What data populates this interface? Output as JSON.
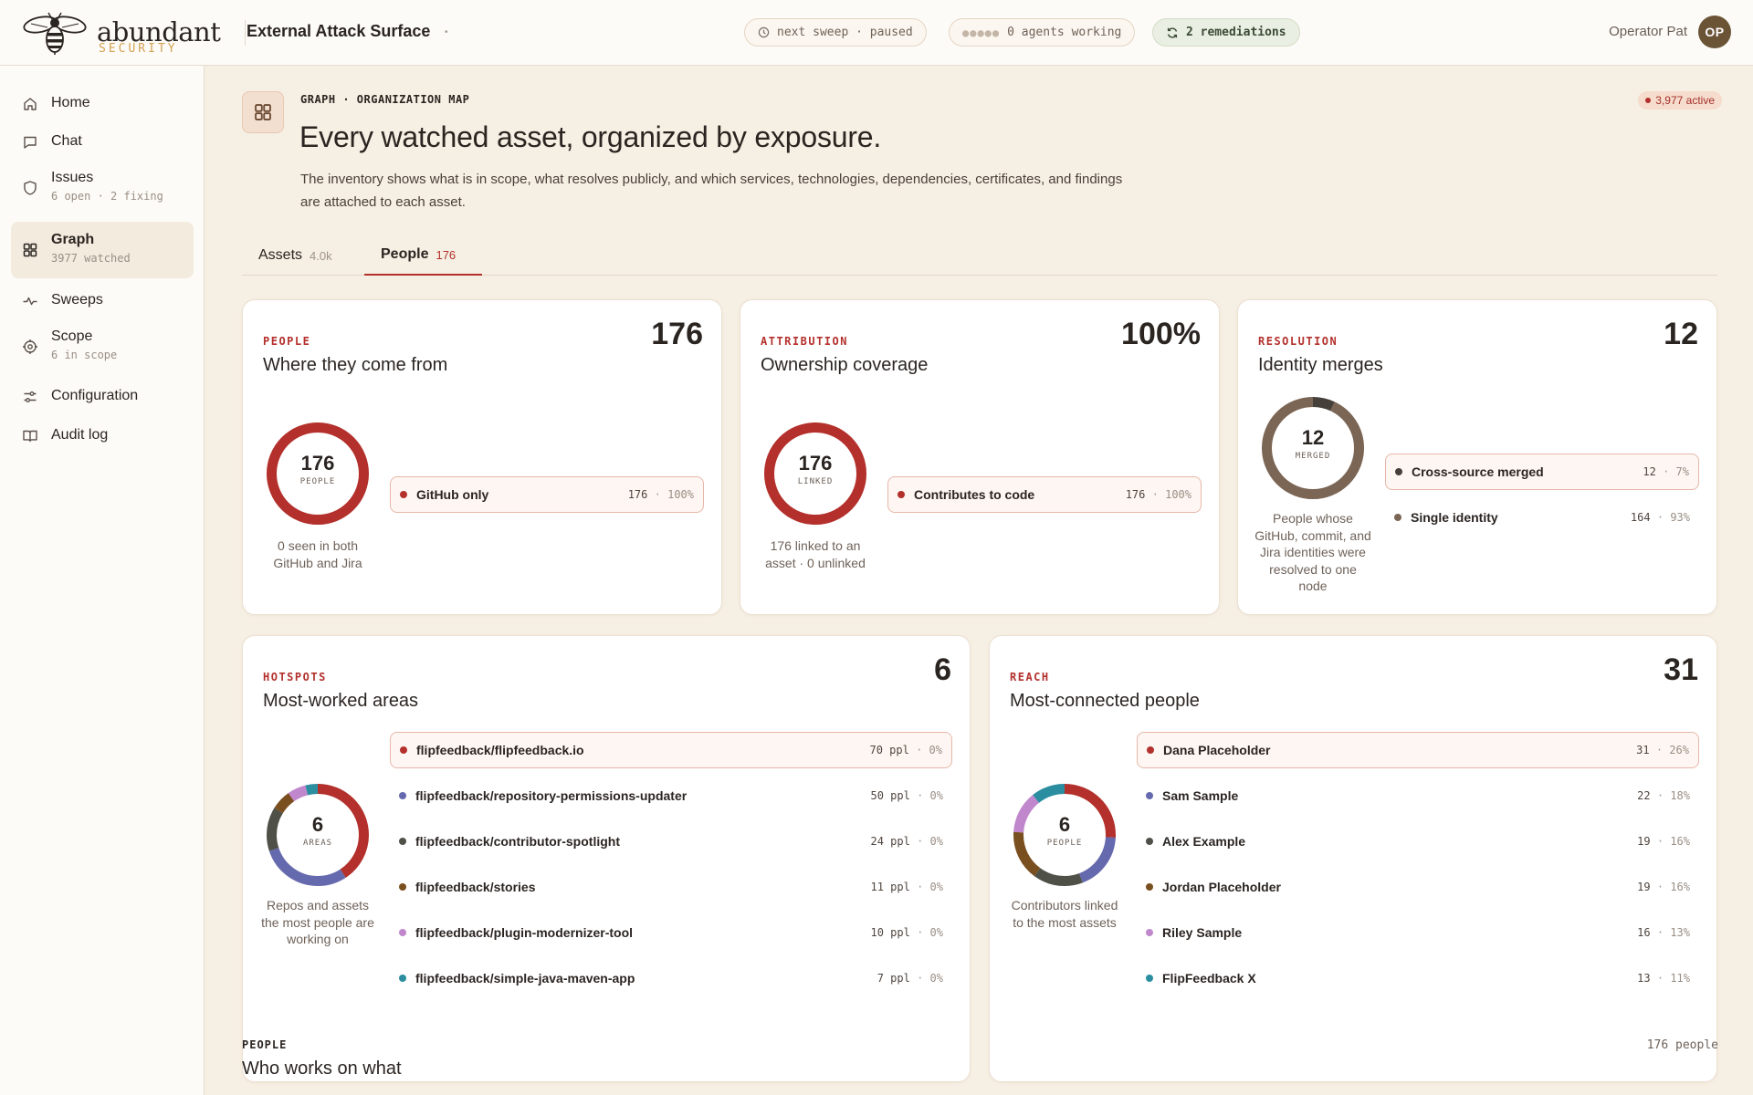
{
  "brand": {
    "name": "abundant",
    "sub": "SECURITY"
  },
  "header": {
    "title": "External Attack Surface",
    "sweep": "next sweep · paused",
    "agents": "0 agents working",
    "remediations": "2 remediations",
    "user_name": "Operator Pat",
    "user_initials": "OP"
  },
  "sidebar": {
    "items": [
      {
        "label": "Home",
        "sub": "",
        "icon": "home-icon"
      },
      {
        "label": "Chat",
        "sub": "",
        "icon": "chat-icon"
      },
      {
        "label": "Issues",
        "sub": "6 open · 2 fixing",
        "icon": "shield-icon"
      },
      {
        "label": "Graph",
        "sub": "3977 watched",
        "icon": "grid-icon"
      },
      {
        "label": "Sweeps",
        "sub": "",
        "icon": "pulse-icon"
      },
      {
        "label": "Scope",
        "sub": "6 in scope",
        "icon": "target-icon"
      },
      {
        "label": "Configuration",
        "sub": "",
        "icon": "sliders-icon"
      },
      {
        "label": "Audit log",
        "sub": "",
        "icon": "book-icon"
      }
    ],
    "active_index": 3
  },
  "page": {
    "kicker": "GRAPH · ORGANIZATION MAP",
    "title": "Every watched asset, organized by exposure.",
    "description": "The inventory shows what is in scope, what resolves publicly, and which services, technologies, dependencies, certificates, and findings are attached to each asset.",
    "active_badge": "3,977 active"
  },
  "tabs": [
    {
      "label": "Assets",
      "count": "4.0k",
      "active": false
    },
    {
      "label": "People",
      "count": "176",
      "active": true
    }
  ],
  "colors": {
    "red": "#b3302c",
    "indigo": "#6569ad",
    "slate": "#4f5048",
    "brown": "#7a4f1f",
    "orchid": "#c087cd",
    "teal": "#2a8ea0",
    "taupe": "#7b6656",
    "dark": "#45413a"
  },
  "cards": {
    "people": {
      "kicker": "PEOPLE",
      "title": "Where they come from",
      "big": "176",
      "donut_value": "176",
      "donut_label": "PEOPLE",
      "caption": "0 seen in both GitHub and Jira",
      "rows": [
        {
          "label": "GitHub only",
          "value": "176",
          "pct": "100%",
          "fraction": 1.0,
          "color": "#b3302c"
        }
      ]
    },
    "attribution": {
      "kicker": "ATTRIBUTION",
      "title": "Ownership coverage",
      "big": "100%",
      "donut_value": "176",
      "donut_label": "LINKED",
      "caption": "176 linked to an asset · 0 unlinked",
      "rows": [
        {
          "label": "Contributes to code",
          "value": "176",
          "pct": "100%",
          "fraction": 1.0,
          "color": "#b3302c"
        }
      ]
    },
    "resolution": {
      "kicker": "RESOLUTION",
      "title": "Identity merges",
      "big": "12",
      "donut_value": "12",
      "donut_label": "MERGED",
      "caption": "People whose GitHub, commit, and Jira identities were resolved to one node",
      "rows": [
        {
          "label": "Cross-source merged",
          "value": "12",
          "pct": "7%",
          "fraction": 0.07,
          "color": "#45413a"
        },
        {
          "label": "Single identity",
          "value": "164",
          "pct": "93%",
          "fraction": 0.93,
          "color": "#7b6656"
        }
      ]
    },
    "hotspots": {
      "kicker": "HOTSPOTS",
      "title": "Most-worked areas",
      "big": "6",
      "donut_value": "6",
      "donut_label": "AREAS",
      "caption": "Repos and assets the most people are working on",
      "rows": [
        {
          "label": "flipfeedback/flipfeedback.io",
          "value": "70 ppl",
          "pct": "0%",
          "weight": 70,
          "color": "#b3302c"
        },
        {
          "label": "flipfeedback/repository-permissions-updater",
          "value": "50 ppl",
          "pct": "0%",
          "weight": 50,
          "color": "#6569ad"
        },
        {
          "label": "flipfeedback/contributor-spotlight",
          "value": "24 ppl",
          "pct": "0%",
          "weight": 24,
          "color": "#4f5048"
        },
        {
          "label": "flipfeedback/stories",
          "value": "11 ppl",
          "pct": "0%",
          "weight": 11,
          "color": "#7a4f1f"
        },
        {
          "label": "flipfeedback/plugin-modernizer-tool",
          "value": "10 ppl",
          "pct": "0%",
          "weight": 10,
          "color": "#c087cd"
        },
        {
          "label": "flipfeedback/simple-java-maven-app",
          "value": "7 ppl",
          "pct": "0%",
          "weight": 7,
          "color": "#2a8ea0"
        }
      ]
    },
    "reach": {
      "kicker": "REACH",
      "title": "Most-connected people",
      "big": "31",
      "donut_value": "6",
      "donut_label": "PEOPLE",
      "caption": "Contributors linked to the most assets",
      "rows": [
        {
          "label": "Dana Placeholder",
          "value": "31",
          "pct": "26%",
          "weight": 31,
          "color": "#b3302c"
        },
        {
          "label": "Sam Sample",
          "value": "22",
          "pct": "18%",
          "weight": 22,
          "color": "#6569ad"
        },
        {
          "label": "Alex Example",
          "value": "19",
          "pct": "16%",
          "weight": 19,
          "color": "#4f5048"
        },
        {
          "label": "Jordan Placeholder",
          "value": "19",
          "pct": "16%",
          "weight": 19,
          "color": "#7a4f1f"
        },
        {
          "label": "Riley Sample",
          "value": "16",
          "pct": "13%",
          "weight": 16,
          "color": "#c087cd"
        },
        {
          "label": "FlipFeedback X",
          "value": "13",
          "pct": "11%",
          "weight": 13,
          "color": "#2a8ea0"
        }
      ]
    }
  },
  "section": {
    "kicker": "PEOPLE",
    "title": "Who works on what",
    "count": "176 people"
  }
}
